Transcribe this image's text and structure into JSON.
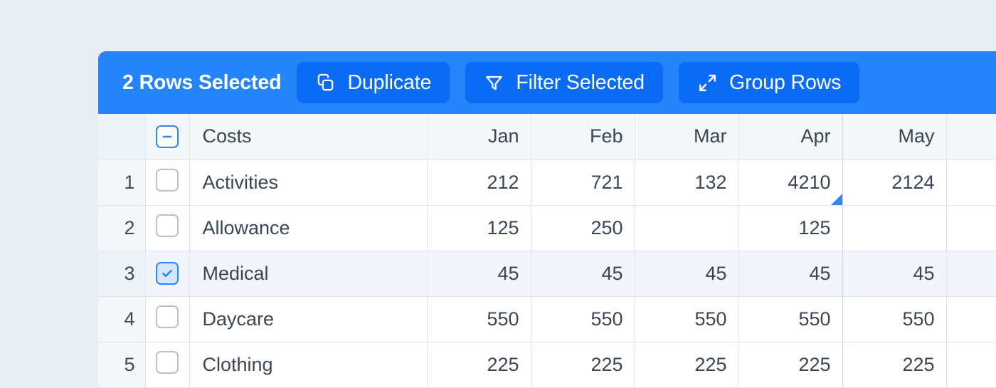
{
  "toolbar": {
    "selection_label": "2 Rows Selected",
    "background_color": "#2684fb",
    "button_color": "#0a6cf5",
    "buttons": [
      {
        "label": "Duplicate",
        "icon": "copy-icon"
      },
      {
        "label": "Filter Selected",
        "icon": "filter-icon"
      },
      {
        "label": "Group Rows",
        "icon": "collapse-arrows-icon"
      }
    ]
  },
  "table": {
    "select_all_state": "indeterminate",
    "columns": [
      {
        "key": "label",
        "header": "Costs",
        "align": "left"
      },
      {
        "key": "jan",
        "header": "Jan",
        "align": "right"
      },
      {
        "key": "feb",
        "header": "Feb",
        "align": "right"
      },
      {
        "key": "mar",
        "header": "Mar",
        "align": "right"
      },
      {
        "key": "apr",
        "header": "Apr",
        "align": "right"
      },
      {
        "key": "may",
        "header": "May",
        "align": "right"
      },
      {
        "key": "extra",
        "header": "",
        "align": "right"
      }
    ],
    "active_cell": {
      "row": 1,
      "column": "apr",
      "value": "4210"
    },
    "active_column": "Apr",
    "rows": [
      {
        "number": "1",
        "checked": false,
        "label": "Activities",
        "values": {
          "jan": "212",
          "feb": "721",
          "mar": "132",
          "apr": "4210",
          "may": "2124",
          "extra": ""
        }
      },
      {
        "number": "2",
        "checked": false,
        "label": "Allowance",
        "values": {
          "jan": "125",
          "feb": "250",
          "mar": "",
          "apr": "125",
          "may": "",
          "extra": ""
        }
      },
      {
        "number": "3",
        "checked": true,
        "label": "Medical",
        "values": {
          "jan": "45",
          "feb": "45",
          "mar": "45",
          "apr": "45",
          "may": "45",
          "extra": ""
        }
      },
      {
        "number": "4",
        "checked": false,
        "label": "Daycare",
        "values": {
          "jan": "550",
          "feb": "550",
          "mar": "550",
          "apr": "550",
          "may": "550",
          "extra": ""
        }
      },
      {
        "number": "5",
        "checked": false,
        "label": "Clothing",
        "values": {
          "jan": "225",
          "feb": "225",
          "mar": "225",
          "apr": "225",
          "may": "225",
          "extra": ""
        }
      }
    ]
  },
  "colors": {
    "page_background": "#e9eef4",
    "accent_blue": "#2f86f6",
    "header_background": "#f3f7fa",
    "selected_row_background": "#f2f6fa",
    "grid_line": "#dfe6ee",
    "text": "#3a4654"
  }
}
